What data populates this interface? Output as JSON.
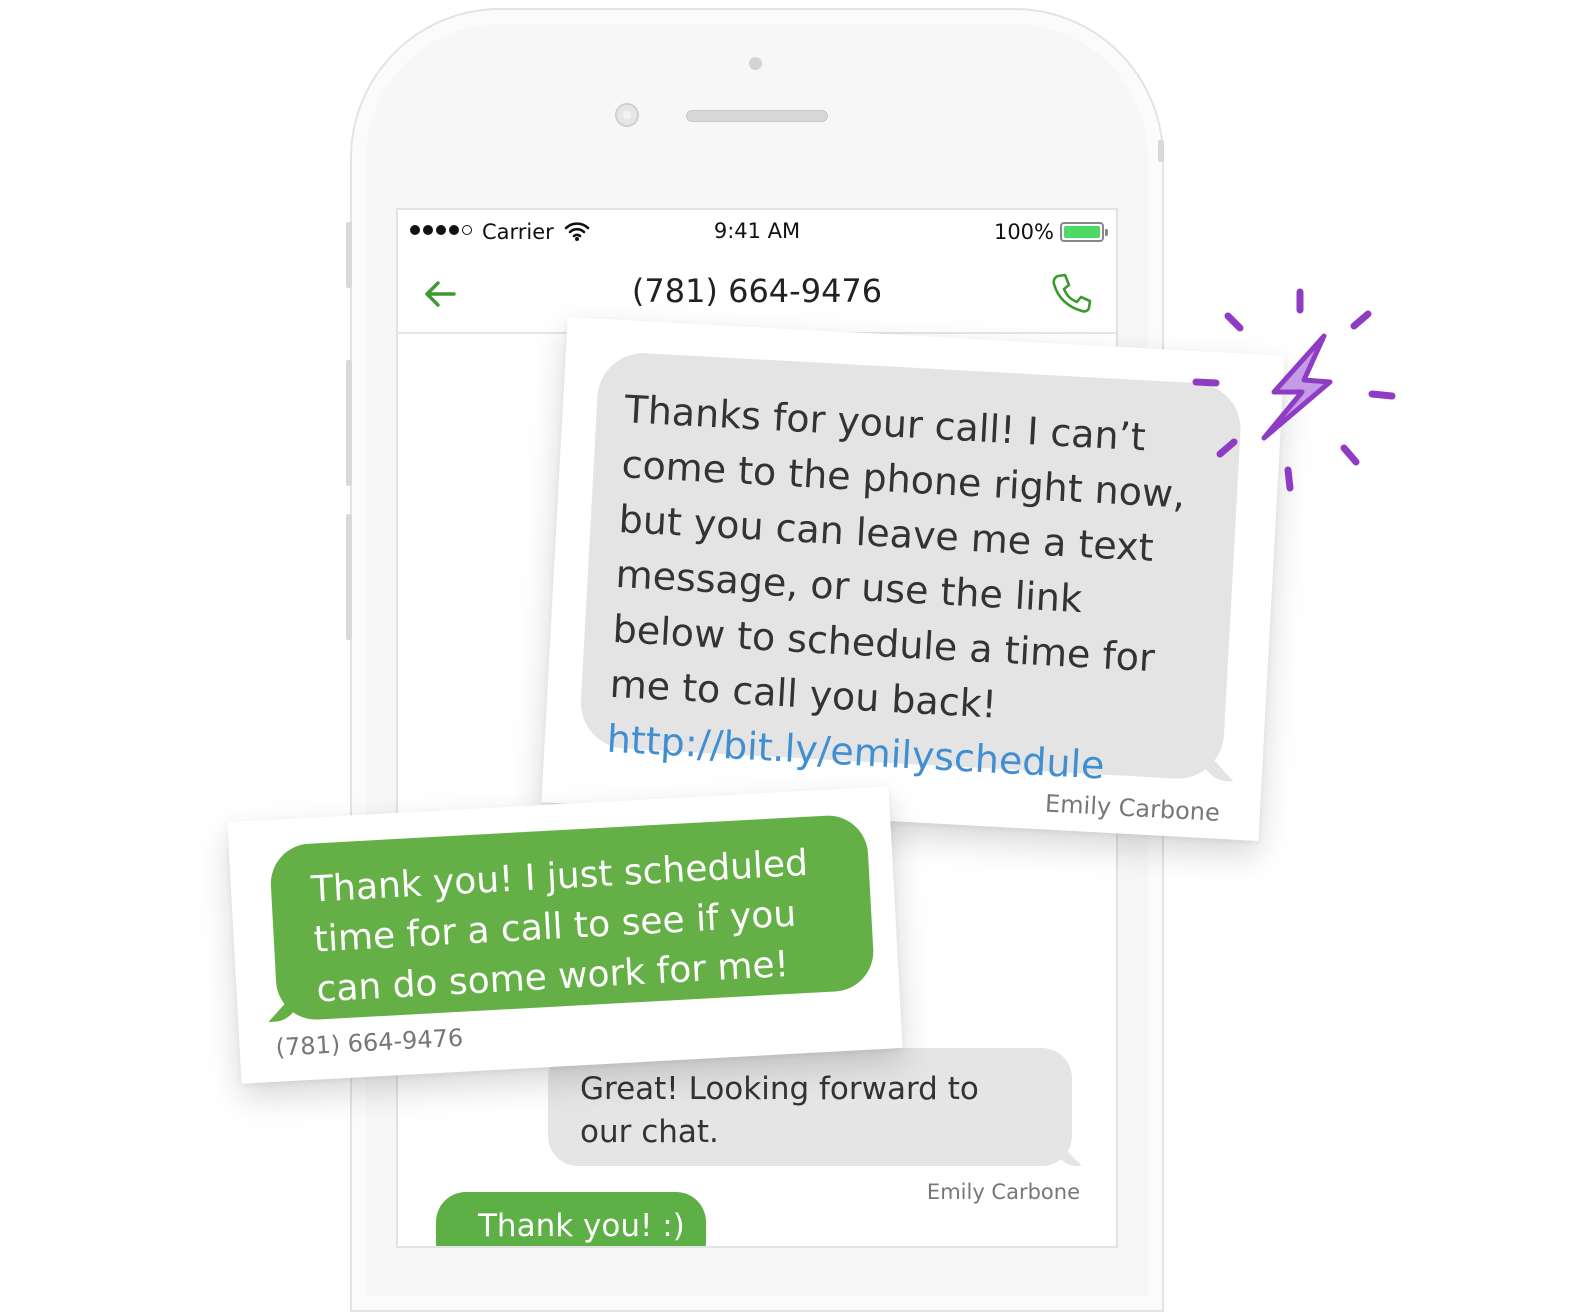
{
  "status_bar": {
    "carrier": "Carrier",
    "time": "9:41 AM",
    "battery": "100%",
    "battery_color": "#4cd964"
  },
  "nav": {
    "title": "(781) 664-9476",
    "back_icon": "back-arrow-icon",
    "call_icon": "phone-icon",
    "accent_color": "#3c9a2f"
  },
  "card_incoming": {
    "message": "Thanks for your call! I can’t come to the phone right now, but you can leave me a text message, or use the link below to schedule a time for me to call you back!",
    "link": "http://bit.ly/emilyschedule",
    "sender": "Emily Carbone"
  },
  "card_outgoing": {
    "message": "Thank you! I just scheduled time for a call to see if you can do some work for me!",
    "sender": "(781) 664-9476"
  },
  "thread": {
    "incoming_message": "Great! Looking forward to our chat.",
    "incoming_sender": "Emily Carbone",
    "outgoing_message": "Thank you! :)"
  },
  "decoration": {
    "icon": "lightning-bolt-icon",
    "color": "#8e3cc4"
  }
}
